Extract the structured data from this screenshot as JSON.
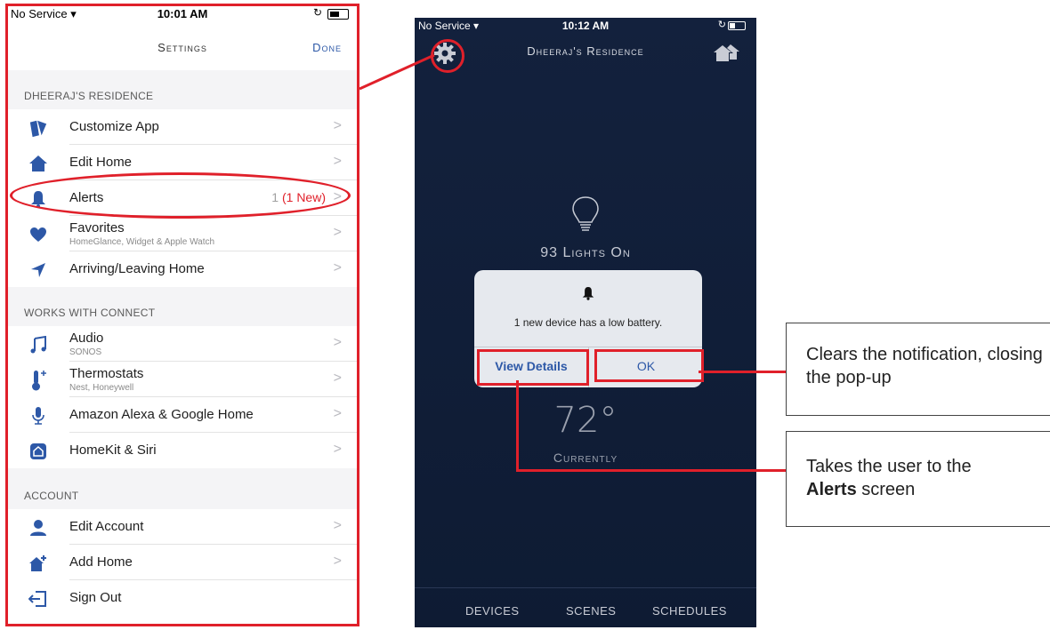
{
  "settings_screen": {
    "status": {
      "carrier": "No Service",
      "time": "10:01 AM"
    },
    "title": "Settings",
    "done": "Done",
    "sections": [
      {
        "header": "DHEERAJ'S RESIDENCE"
      },
      {
        "header": "WORKS WITH CONNECT"
      },
      {
        "header": "ACCOUNT"
      }
    ],
    "rows": {
      "customize": {
        "label": "Customize App",
        "icon": "cards-icon"
      },
      "edit_home": {
        "label": "Edit Home",
        "icon": "home-icon"
      },
      "alerts": {
        "label": "Alerts",
        "count": "1",
        "new": "(1 New)",
        "icon": "bell-icon"
      },
      "favorites": {
        "label": "Favorites",
        "sub": "HomeGlance, Widget & Apple Watch",
        "icon": "heart-icon"
      },
      "arriving": {
        "label": "Arriving/Leaving Home",
        "icon": "location-arrow-icon"
      },
      "audio": {
        "label": "Audio",
        "sub": "SONOS",
        "icon": "music-note-icon"
      },
      "thermostats": {
        "label": "Thermostats",
        "sub": "Nest, Honeywell",
        "icon": "thermometer-icon"
      },
      "alexa": {
        "label": "Amazon Alexa & Google Home",
        "icon": "microphone-icon"
      },
      "homekit": {
        "label": "HomeKit & Siri",
        "icon": "homekit-icon"
      },
      "edit_account": {
        "label": "Edit Account",
        "icon": "person-icon"
      },
      "add_home": {
        "label": "Add Home",
        "icon": "add-home-icon"
      },
      "sign_out": {
        "label": "Sign Out",
        "icon": "sign-out-icon"
      }
    },
    "chevron": ">"
  },
  "home_screen": {
    "status": {
      "carrier": "No Service",
      "time": "10:12 AM"
    },
    "title": "Dheeraj's Residence",
    "lights_on": "93 Lights On",
    "temperature": "72°",
    "currently": "Currently",
    "tabs": [
      "DEVICES",
      "SCENES",
      "SCHEDULES"
    ],
    "dialog": {
      "message": "1 new device has a low battery.",
      "view_details": "View Details",
      "ok": "OK"
    }
  },
  "callouts": {
    "ok": "Clears the notification, closing the pop-up",
    "view_prefix": "Takes the user to the",
    "view_bold": "Alerts",
    "view_suffix": " screen"
  },
  "colors": {
    "accent_red": "#e0202a",
    "ios_blue": "#2d58a7",
    "dark_bg": "#13213d"
  }
}
